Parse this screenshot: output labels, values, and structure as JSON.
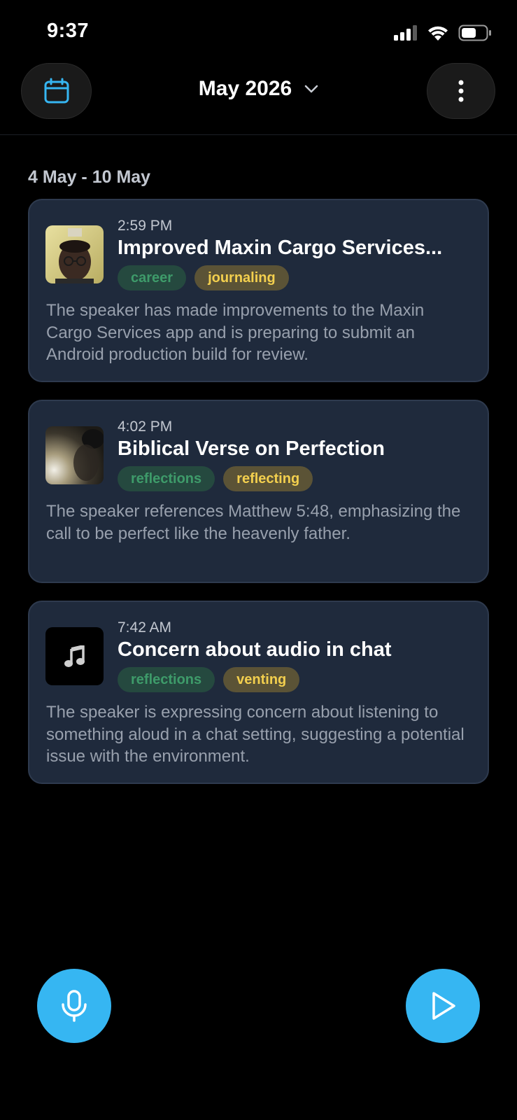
{
  "status_bar": {
    "time": "9:37"
  },
  "header": {
    "month": "May 2026"
  },
  "week": {
    "label": "4 May - 10 May"
  },
  "entries": [
    {
      "time": "2:59 PM",
      "title": "Improved Maxin Cargo Services...",
      "tags": [
        "career",
        "journaling"
      ],
      "summary": "The speaker has made improvements to the Maxin Cargo Services app and is preparing to submit an Android production build for review."
    },
    {
      "time": "4:02 PM",
      "title": "Biblical Verse on Perfection",
      "tags": [
        "reflections",
        "reflecting"
      ],
      "summary": "The speaker references Matthew 5:48, emphasizing the call to be perfect like the heavenly father."
    },
    {
      "time": "7:42 AM",
      "title": "Concern about audio in chat",
      "tags": [
        "reflections",
        "venting"
      ],
      "summary": "The speaker is expressing concern about listening to something aloud in a chat setting, suggesting a potential issue with the environment."
    }
  ],
  "icons": {
    "calendar": "calendar-icon",
    "dropdown": "chevron-down-icon",
    "more": "more-vertical-icon",
    "audio_thumb": "music-note-icon",
    "record": "microphone-icon",
    "play": "play-icon"
  },
  "colors": {
    "accent": "#36b6f2",
    "card_bg": "#1f2a3c",
    "tag_green_bg": "#25493f",
    "tag_green_text": "#3e9b6a",
    "tag_yellow_bg": "#5b5336",
    "tag_yellow_text": "#f3cf4e"
  }
}
